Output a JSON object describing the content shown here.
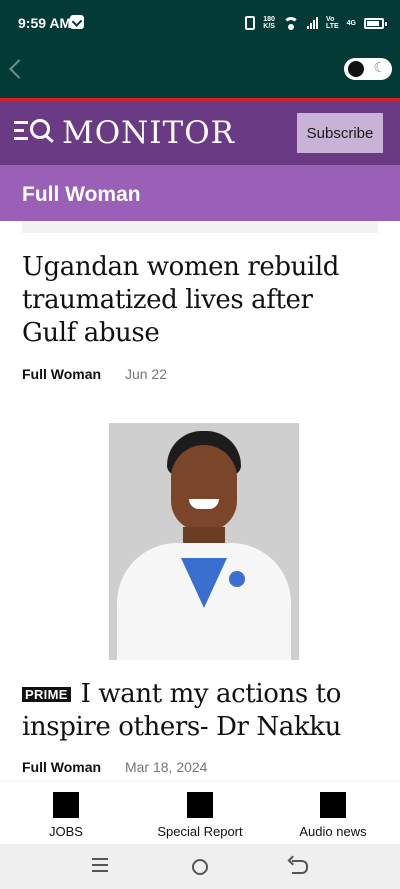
{
  "status_bar": {
    "time": "9:59 AM",
    "data_speed_top": "180",
    "data_speed_unit": "K/S",
    "volte_top": "Vo",
    "volte_bottom": "LTE",
    "network": "4G",
    "icons": [
      "app-notification-icon",
      "vibrate-icon",
      "wifi-icon",
      "signal-icon",
      "battery-icon"
    ]
  },
  "toolbar": {
    "back_icon": "chevron-left-icon",
    "dark_mode_icon": "moon-icon"
  },
  "header": {
    "logo_text": "MONITOR",
    "subscribe_label": "Subscribe",
    "colors": {
      "header_bg": "#6a3a85",
      "accent_line": "#d4201e",
      "section_bg": "#9a60b7"
    }
  },
  "section": {
    "title": "Full Woman"
  },
  "articles": [
    {
      "headline": "Ugandan women rebuild traumatized lives after Gulf abuse",
      "category": "Full Woman",
      "date": "Jun 22"
    },
    {
      "badge": "PRIME",
      "headline": "I want my actions to inspire others- Dr Nakku",
      "category": "Full Woman",
      "date": "Mar 18, 2024",
      "image_alt": "Dr Nakku in white coat"
    }
  ],
  "bottom_nav": [
    {
      "label": "JOBS",
      "icon": "jobs-icon"
    },
    {
      "label": "Special Report",
      "icon": "special-report-icon"
    },
    {
      "label": "Audio news",
      "icon": "audio-news-icon"
    }
  ],
  "system_nav": {
    "icons": [
      "recent-apps-icon",
      "home-icon",
      "back-icon"
    ]
  }
}
